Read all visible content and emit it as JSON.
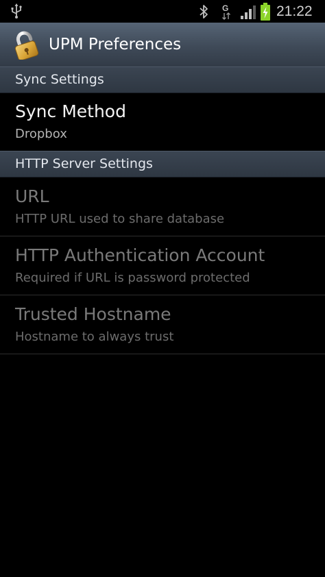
{
  "status_bar": {
    "time": "21:22",
    "network_type": "G",
    "icons": [
      "usb-icon",
      "bluetooth-icon",
      "gprs-signal-icon",
      "cell-signal-icon",
      "battery-charging-icon"
    ]
  },
  "action_bar": {
    "title": "UPM Preferences",
    "icon": "padlock-icon"
  },
  "sections": [
    {
      "header": "Sync Settings",
      "items": [
        {
          "title": "Sync Method",
          "summary": "Dropbox",
          "enabled": true
        }
      ]
    },
    {
      "header": "HTTP Server Settings",
      "items": [
        {
          "title": "URL",
          "summary": "HTTP URL used to share database",
          "enabled": false
        },
        {
          "title": "HTTP Authentication Account",
          "summary": "Required if URL is password protected",
          "enabled": false
        },
        {
          "title": "Trusted Hostname",
          "summary": "Hostname to always trust",
          "enabled": false
        }
      ]
    }
  ],
  "colors": {
    "background": "#000000",
    "action_bar": "#46525f",
    "category_header": "#343d49",
    "battery_charging": "#8cd42a"
  }
}
